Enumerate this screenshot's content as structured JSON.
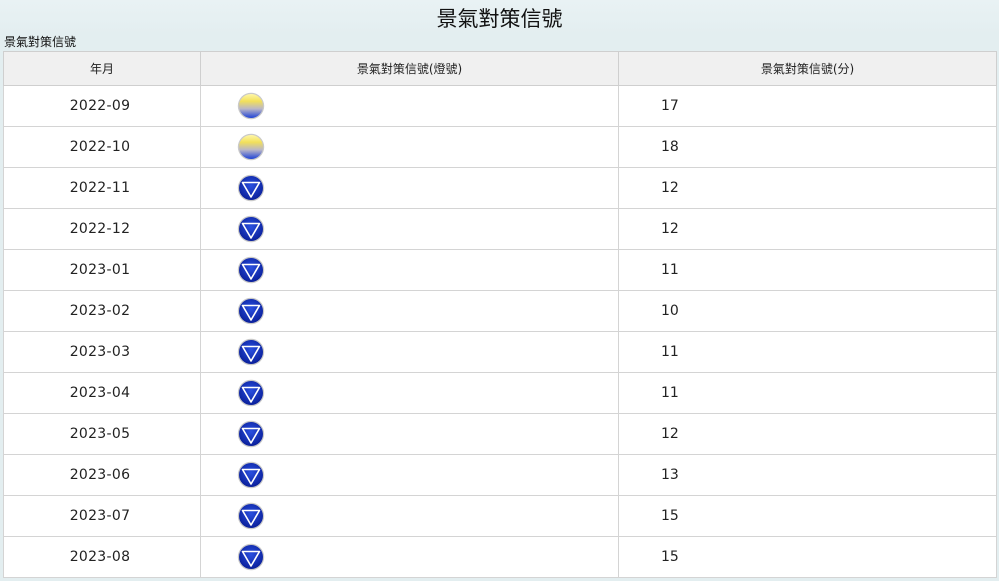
{
  "page": {
    "title": "景氣對策信號",
    "caption": "景氣對策信號"
  },
  "table": {
    "headers": [
      "年月",
      "景氣對策信號(燈號)",
      "景氣對策信號(分)"
    ],
    "rows": [
      {
        "month": "2022-09",
        "light": "yellow-blue",
        "score": "17"
      },
      {
        "month": "2022-10",
        "light": "yellow-blue",
        "score": "18"
      },
      {
        "month": "2022-11",
        "light": "blue",
        "score": "12"
      },
      {
        "month": "2022-12",
        "light": "blue",
        "score": "12"
      },
      {
        "month": "2023-01",
        "light": "blue",
        "score": "11"
      },
      {
        "month": "2023-02",
        "light": "blue",
        "score": "10"
      },
      {
        "month": "2023-03",
        "light": "blue",
        "score": "11"
      },
      {
        "month": "2023-04",
        "light": "blue",
        "score": "11"
      },
      {
        "month": "2023-05",
        "light": "blue",
        "score": "12"
      },
      {
        "month": "2023-06",
        "light": "blue",
        "score": "13"
      },
      {
        "month": "2023-07",
        "light": "blue",
        "score": "15"
      },
      {
        "month": "2023-08",
        "light": "blue",
        "score": "15"
      }
    ]
  },
  "colors": {
    "blue": "#1234c8",
    "yellow": "#f2e05a",
    "header_bg": "#f0f0f0",
    "page_bg": "#e3eef0"
  }
}
